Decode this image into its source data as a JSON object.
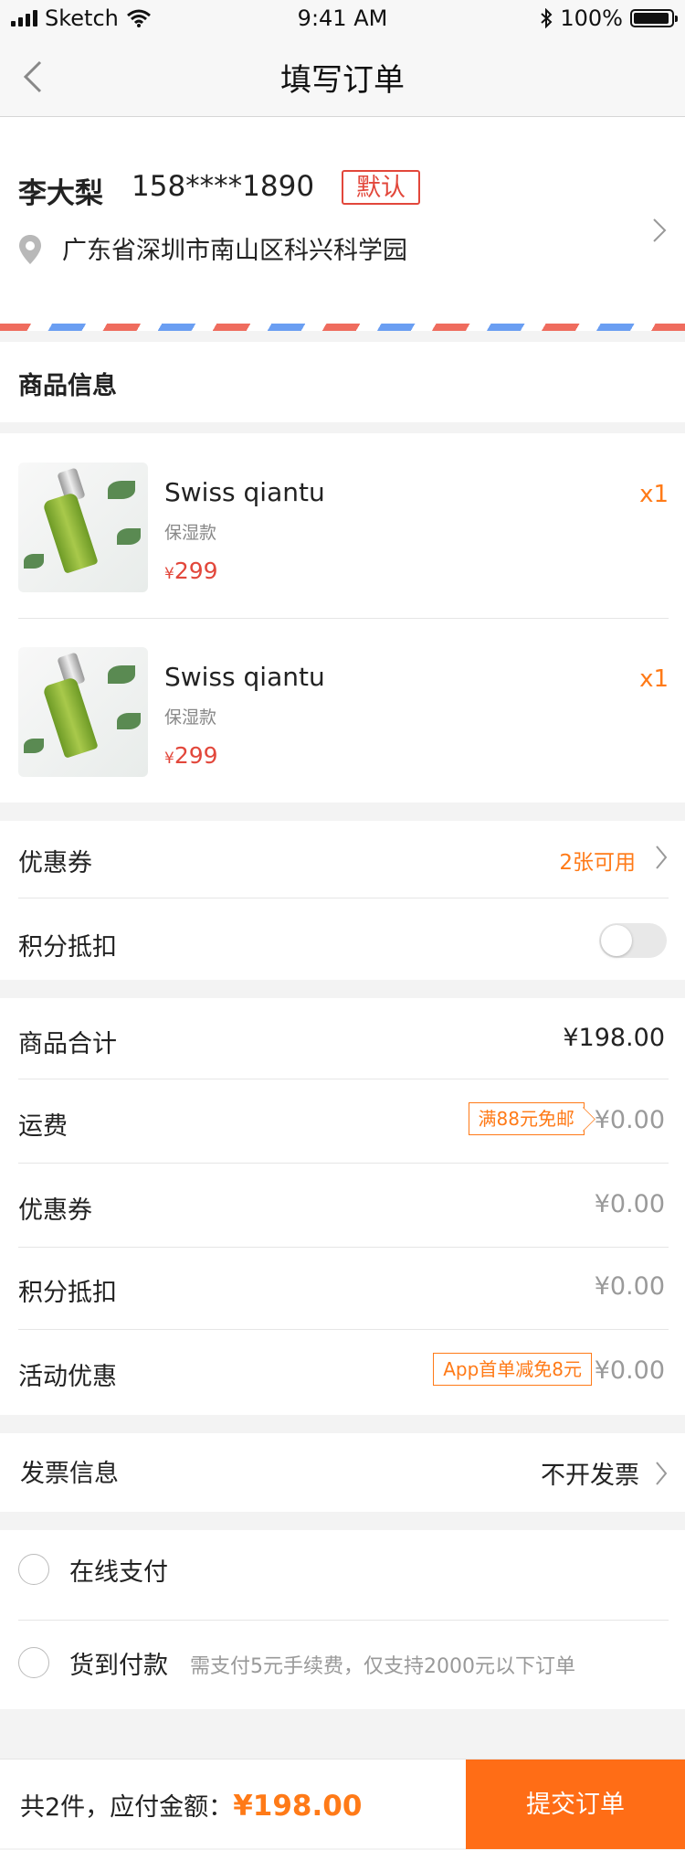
{
  "status_bar": {
    "carrier": "Sketch",
    "time": "9:41 AM",
    "battery": "100%"
  },
  "nav": {
    "title": "填写订单"
  },
  "address": {
    "name": "李大梨",
    "phone": "158****1890",
    "tag": "默认",
    "detail": "广东省深圳市南山区科兴科学园"
  },
  "goods": {
    "section_title": "商品信息",
    "items": [
      {
        "name": "Swiss qiantu",
        "spec": "保湿款",
        "currency": "¥",
        "price": "299",
        "qty": "x1"
      },
      {
        "name": "Swiss qiantu",
        "spec": "保湿款",
        "currency": "¥",
        "price": "299",
        "qty": "x1"
      }
    ]
  },
  "discounts": {
    "coupon_label": "优惠券",
    "coupon_value": "2张可用",
    "points_label": "积分抵扣",
    "points_enabled": false
  },
  "costs": {
    "subtotal_label": "商品合计",
    "subtotal_value": "¥198.00",
    "shipping_label": "运费",
    "shipping_badge": "满88元免邮",
    "shipping_value": "¥0.00",
    "coupon_label": "优惠券",
    "coupon_value": "¥0.00",
    "points_label": "积分抵扣",
    "points_value": "¥0.00",
    "promo_label": "活动优惠",
    "promo_badge": "App首单减免8元",
    "promo_value": "¥0.00"
  },
  "invoice": {
    "label": "发票信息",
    "value": "不开发票"
  },
  "payment": {
    "online_label": "在线支付",
    "cod_label": "货到付款",
    "cod_note": "需支付5元手续费，仅支持2000元以下订单"
  },
  "footer": {
    "summary_prefix": "共2件，应付金额：",
    "total": "¥198.00",
    "submit_label": "提交订单"
  },
  "colors": {
    "accent": "#ff6d16",
    "price_red": "#e2473b",
    "airmail_red": "#ef6c5e",
    "airmail_blue": "#6a9ef2"
  }
}
